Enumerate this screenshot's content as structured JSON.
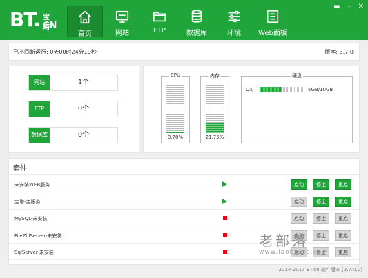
{
  "header": {
    "logo_text": "BT.",
    "logo_zh": "宝塔",
    "logo_cn": "CN",
    "nav": [
      {
        "label": "首页",
        "icon": "home-icon"
      },
      {
        "label": "网站",
        "icon": "monitor-icon"
      },
      {
        "label": "FTP",
        "icon": "folder-icon"
      },
      {
        "label": "数据库",
        "icon": "database-icon"
      },
      {
        "label": "环境",
        "icon": "sliders-icon"
      },
      {
        "label": "Web面板",
        "icon": "panel-list-icon"
      }
    ],
    "window_controls": [
      "▬",
      "-",
      "✕"
    ]
  },
  "status": {
    "uptime": "已不间断运行: 0天00时24分19秒",
    "version": "版本: 3.7.0"
  },
  "stats": [
    {
      "label": "网站",
      "value": "1个"
    },
    {
      "label": "FTP",
      "value": "0个"
    },
    {
      "label": "数据库",
      "value": "0个"
    }
  ],
  "gauges": {
    "cpu": {
      "title": "CPU",
      "percent": "0.78%",
      "level": 0.78
    },
    "mem": {
      "title": "内存",
      "percent": "21.75%",
      "level": 21.75
    },
    "disk": {
      "title": "硬盘",
      "drive": "C:\\",
      "usage": "5GB/10GB",
      "level": 50
    }
  },
  "services": {
    "title": "套件",
    "rows": [
      {
        "name": "未安装WEB服务",
        "state": "run",
        "start": "启动",
        "stop": "停止",
        "restart": "重启",
        "start_on": true,
        "stop_on": true,
        "restart_on": true
      },
      {
        "name": "宝塔-主服务",
        "state": "run",
        "start": "启动",
        "stop": "停止",
        "restart": "重启",
        "start_on": false,
        "stop_on": true,
        "restart_on": true
      },
      {
        "name": "MySQL-未安装",
        "state": "stop",
        "start": "启动",
        "stop": "停止",
        "restart": "重启",
        "start_on": false,
        "stop_on": false,
        "restart_on": false
      },
      {
        "name": "FileZillServer-未安装",
        "state": "stop",
        "start": "启动",
        "stop": "停止",
        "restart": "重启",
        "start_on": false,
        "stop_on": false,
        "restart_on": false
      },
      {
        "name": "SqlServer-未安装",
        "state": "stop",
        "start": "启动",
        "stop": "停止",
        "restart": "重启",
        "start_on": false,
        "stop_on": false,
        "restart_on": false
      }
    ]
  },
  "footer": {
    "copyright": "2014-2017 BT.cn  软件版本 [3.7.0.0]"
  },
  "watermark": {
    "line1": "老部落",
    "line2": "www.laobuluo.com"
  },
  "colors": {
    "brand": "#20a53a",
    "stop": "#e60012"
  }
}
